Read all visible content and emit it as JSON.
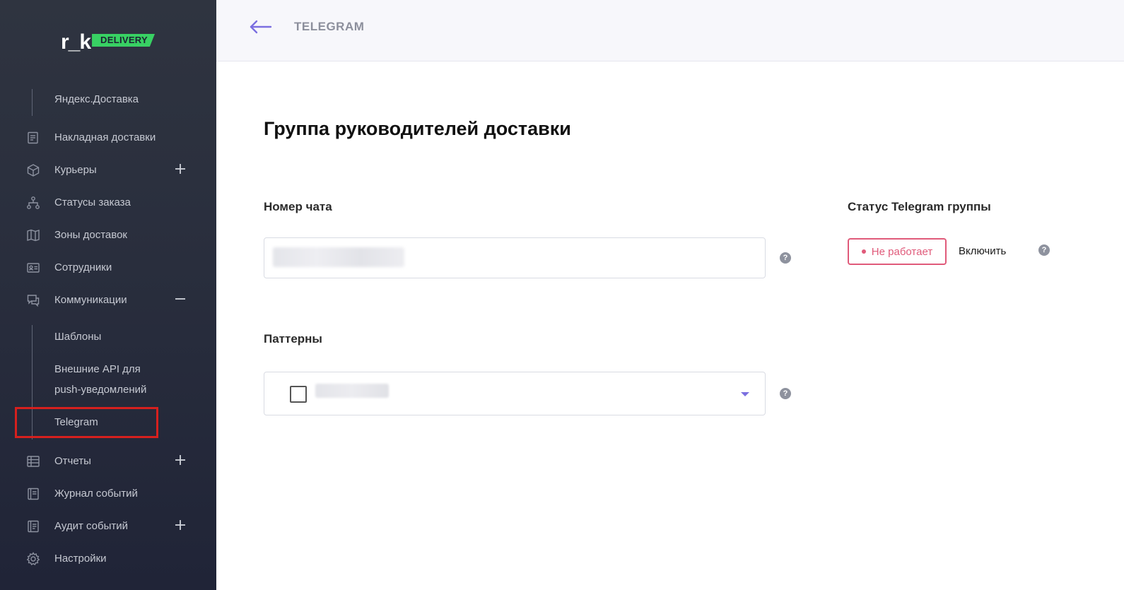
{
  "brand": {
    "logo_text": "r_k",
    "logo_badge": "DELIVERY"
  },
  "sidebar": {
    "items": [
      {
        "label": "Яндекс.Доставка",
        "icon": "none",
        "sub": true
      },
      {
        "label": "Накладная доставки",
        "icon": "invoice-icon"
      },
      {
        "label": "Курьеры",
        "icon": "box-icon",
        "toggle": "+"
      },
      {
        "label": "Статусы заказа",
        "icon": "hierarchy-icon"
      },
      {
        "label": "Зоны доставок",
        "icon": "map-icon"
      },
      {
        "label": "Сотрудники",
        "icon": "id-card-icon"
      },
      {
        "label": "Коммуникации",
        "icon": "chat-icon",
        "toggle": "–"
      },
      {
        "label": "Шаблоны",
        "sub": true
      },
      {
        "label": "Внешние API для",
        "label2": "push-уведомлений",
        "sub": true
      },
      {
        "label": "Telegram",
        "sub": true,
        "active": true
      },
      {
        "label": "Отчеты",
        "icon": "table-icon",
        "toggle": "+"
      },
      {
        "label": "Журнал событий",
        "icon": "journal-icon"
      },
      {
        "label": "Аудит событий",
        "icon": "audit-icon",
        "toggle": "+"
      },
      {
        "label": "Настройки",
        "icon": "gear-icon"
      }
    ]
  },
  "header": {
    "title": "TELEGRAM",
    "back_icon": "arrow-left-icon"
  },
  "main": {
    "title": "Группа руководителей доставки",
    "chat_number": {
      "label": "Номер чата",
      "help": "?"
    },
    "patterns": {
      "label": "Паттерны",
      "help": "?"
    },
    "telegram_status": {
      "label": "Статус Telegram группы",
      "status_text": "Не работает",
      "enable_label": "Включить",
      "help": "?"
    }
  },
  "colors": {
    "sidebar_bg": "#2a2f3e",
    "accent": "#7b6fe0",
    "brand_green": "#38d163",
    "status_error": "#e05a7a",
    "highlight": "#d6201e"
  }
}
